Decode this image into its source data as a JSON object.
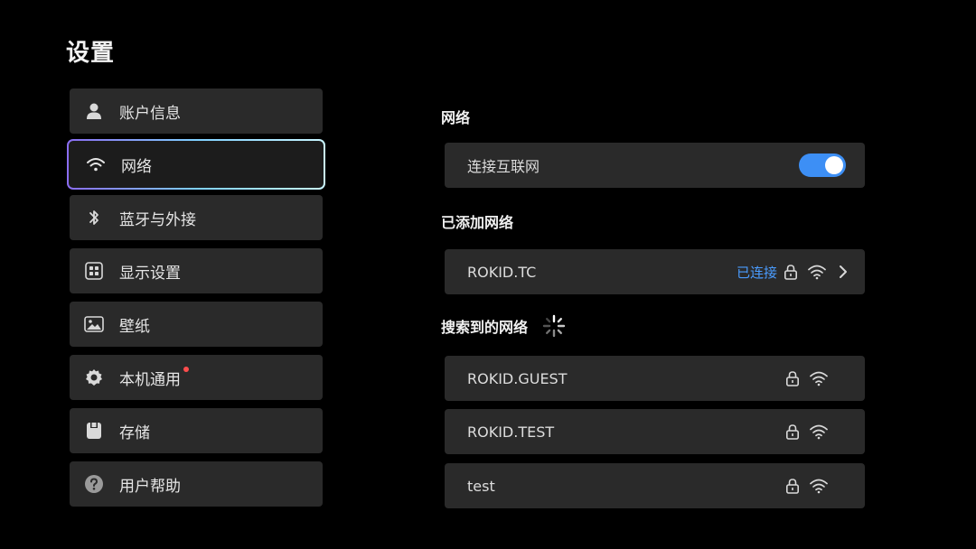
{
  "page": {
    "title": "设置"
  },
  "sidebar": {
    "items": [
      {
        "label": "账户信息",
        "icon": "user-icon"
      },
      {
        "label": "网络",
        "icon": "wifi-icon",
        "selected": true
      },
      {
        "label": "蓝牙与外接",
        "icon": "bluetooth-icon"
      },
      {
        "label": "显示设置",
        "icon": "display-grid-icon"
      },
      {
        "label": "壁纸",
        "icon": "image-icon"
      },
      {
        "label": "本机通用",
        "icon": "gear-icon",
        "badge": "red-dot"
      },
      {
        "label": "存储",
        "icon": "storage-icon"
      },
      {
        "label": "用户帮助",
        "icon": "help-icon"
      }
    ]
  },
  "network": {
    "section_title": "网络",
    "connect_label": "连接互联网",
    "connect_enabled": true
  },
  "added_networks": {
    "section_title": "已添加网络",
    "items": [
      {
        "name": "ROKID.TC",
        "status": "已连接",
        "locked": true
      }
    ]
  },
  "found_networks": {
    "section_title": "搜索到的网络",
    "items": [
      {
        "name": "ROKID.GUEST",
        "locked": true
      },
      {
        "name": "ROKID.TEST",
        "locked": true
      },
      {
        "name": "test",
        "locked": true
      }
    ]
  },
  "colors": {
    "accent": "#3d8ff5",
    "status_connected": "#4a9cff",
    "badge_red": "#ff4d4d",
    "card_bg": "#2a2a2a",
    "page_bg": "#000000"
  }
}
